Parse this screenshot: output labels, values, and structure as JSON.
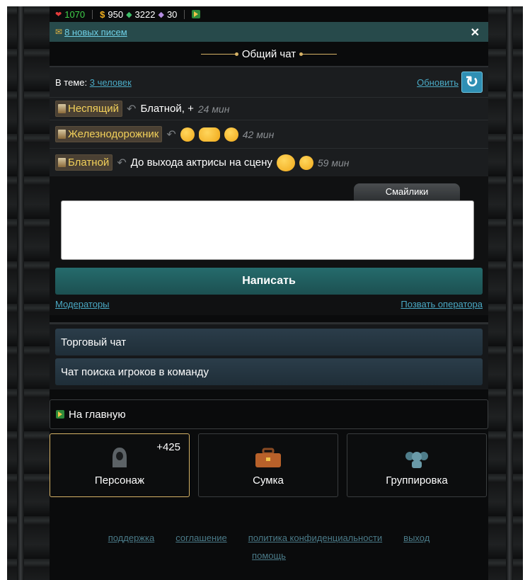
{
  "status": {
    "hp": "1070",
    "money": "950",
    "green": "3222",
    "purple": "30"
  },
  "mail": {
    "text": "8 новых писем",
    "close": "✕"
  },
  "chat": {
    "title": "Общий чат",
    "topic_label": "В теме:",
    "topic_count": "3 человек",
    "refresh_label": "Обновить",
    "messages": [
      {
        "nick": "Неспящий",
        "text": "Блатной, +",
        "time": "24 мин"
      },
      {
        "nick": "Железнодорожник",
        "text": "",
        "time": "42 мин"
      },
      {
        "nick": "Блатной",
        "text": "До выхода актрисы на сцену",
        "time": "59 мин"
      }
    ]
  },
  "compose": {
    "smileys_tab": "Смайлики",
    "send_label": "Написать",
    "moderators": "Модераторы",
    "call_operator": "Позвать оператора"
  },
  "rooms": [
    {
      "label": "Торговый чат"
    },
    {
      "label": "Чат поиска игроков в команду"
    }
  ],
  "nav": {
    "home": "На главную",
    "tiles": [
      {
        "label": "Персонаж",
        "badge": "+425",
        "icon": "character-icon"
      },
      {
        "label": "Сумка",
        "icon": "bag-icon"
      },
      {
        "label": "Группировка",
        "icon": "group-icon"
      }
    ]
  },
  "footer": {
    "support": "поддержка",
    "agreement": "соглашение",
    "privacy": "политика конфиденциальности",
    "logout": "выход",
    "help": "помощь"
  },
  "colors": {
    "accent_gold": "#d6b266",
    "teal_button": "#256b6c",
    "link": "#4aa9c4"
  }
}
